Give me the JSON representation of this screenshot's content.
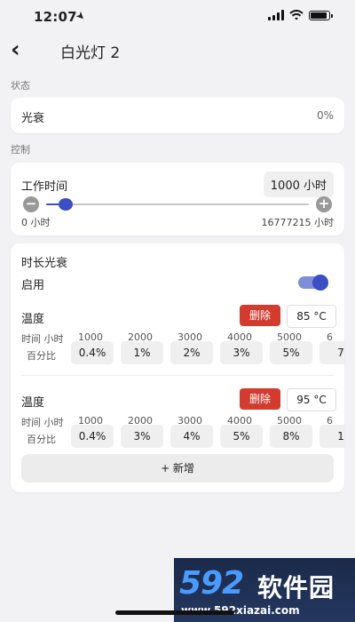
{
  "status_bar": {
    "time": "12:07"
  },
  "nav": {
    "title": "白光灯 2"
  },
  "status_section": {
    "label": "状态",
    "item_name": "光衰",
    "item_value": "0%"
  },
  "control_section": {
    "label": "控制",
    "work_time_label": "工作时间",
    "work_time_value": "1000 小时",
    "slider_min_label": "0 小时",
    "slider_max_label": "16777215 小时",
    "slider_min": 0,
    "slider_max": 16777215,
    "slider_value": 1000
  },
  "decay_card": {
    "title": "时长光衰",
    "enable_label": "启用",
    "enabled": true,
    "temp_label": "温度",
    "delete_label": "删除",
    "time_row_label": "时间 小时",
    "pct_row_label": "百分比",
    "blocks": [
      {
        "temperature": "85 °C",
        "hours": [
          "1000",
          "2000",
          "3000",
          "4000",
          "5000",
          "6"
        ],
        "percents": [
          "0.4%",
          "1%",
          "2%",
          "3%",
          "5%",
          "7"
        ]
      },
      {
        "temperature": "95 °C",
        "hours": [
          "1000",
          "2000",
          "3000",
          "4000",
          "5000",
          "6"
        ],
        "percents": [
          "0.4%",
          "3%",
          "4%",
          "5%",
          "8%",
          "1"
        ]
      }
    ],
    "add_label": "+ 新增"
  },
  "watermark": {
    "logo": "592",
    "text": "软件园",
    "url": "www.592xiazai.com"
  },
  "colors": {
    "accent": "#3a4fc4",
    "danger": "#d33b2f",
    "background": "#f2f2f5"
  }
}
